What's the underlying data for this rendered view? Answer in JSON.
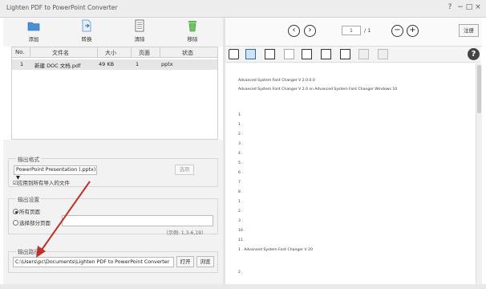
{
  "window": {
    "title": "Lighten PDF to PowerPoint Converter",
    "help_ctl": "?",
    "min_ctl": "−",
    "max_ctl": "□",
    "close_ctl": "×"
  },
  "toolbar": {
    "add_label": "添加",
    "convert_label": "转换",
    "delete_label": "清除",
    "remove_label": "移除"
  },
  "viewer": {
    "prev_icon": "‹",
    "next_icon": "›",
    "page_current": "1",
    "page_total": "/ 1",
    "zoom_out": "−",
    "zoom_in": "+",
    "register_label": "注册",
    "help_icon": "?"
  },
  "table": {
    "headers": [
      "No.",
      "文件名",
      "大小",
      "页面",
      "状态"
    ],
    "rows": [
      {
        "no": "1",
        "name": "新建 DOC 文档.pdf",
        "size": "49 KB",
        "pages": "1",
        "status": "pptx"
      }
    ]
  },
  "output_format": {
    "section_label": "输出格式",
    "selected": "PowerPoint Presentation (.pptx) ▼",
    "options_button": "选项",
    "apply_all_label": "☑应用到所有导入的文件"
  },
  "output_settings": {
    "section_label": "输出设置",
    "all_pages_label": "所有页面",
    "select_pages_label": "选择部分页面",
    "example": "（示例: 1,3-6,19）"
  },
  "output_path": {
    "section_label": "输出路径",
    "path_value": "C:\\Users\\pc\\Documents\\Lighten PDF to PowerPoint Converter",
    "open_button": "打开",
    "browse_button": "浏览"
  },
  "document_lines": [
    "Advanced System Font Changer V 2.0.0.0",
    "Advanced System Font Changer V 2.0 sn Advanced System Font Changer Windows 10",
    "1.",
    "1 .",
    "2 .",
    "3 .",
    "4 .",
    "5 .",
    "6 .",
    "7 .",
    "8 .",
    "1 .",
    "2 .",
    "3 .",
    "10 .",
    "11 .",
    "1 .  Advanced System Font Changer V 20",
    "2 ."
  ]
}
